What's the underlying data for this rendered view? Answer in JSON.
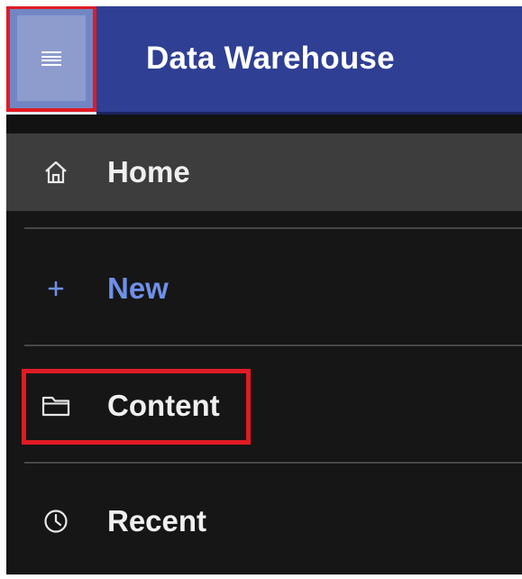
{
  "header": {
    "menu_button": "menu-icon",
    "title": "Data Warehouse"
  },
  "nav": {
    "items": [
      {
        "label": "Home",
        "icon": "home-icon"
      },
      {
        "label": "New",
        "icon": "plus-icon"
      },
      {
        "label": "Content",
        "icon": "folder-icon"
      },
      {
        "label": "Recent",
        "icon": "clock-icon"
      }
    ]
  },
  "colors": {
    "header_bg": "#2f3f93",
    "sidebar_bg": "#161616",
    "selected_item_bg": "#3d3d3d",
    "new_label": "#6f90e8",
    "annotation_red": "#e01b24"
  }
}
